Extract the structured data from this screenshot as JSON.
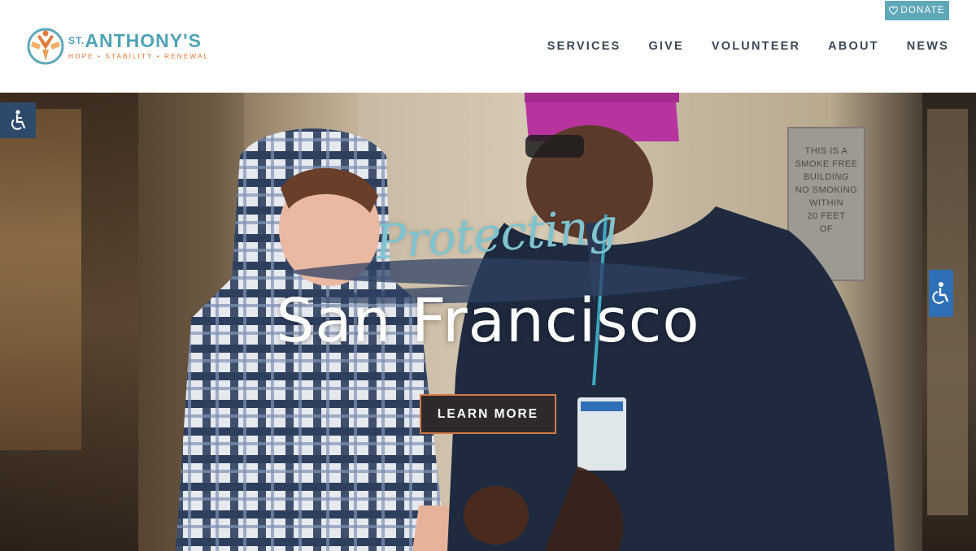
{
  "header": {
    "donate_label": "DONATE",
    "logo": {
      "name_prefix": "ST.",
      "name": "ANTHONY'S",
      "tagline": "HOPE • STABILITY • RENEWAL"
    },
    "nav": [
      {
        "label": "SERVICES"
      },
      {
        "label": "GIVE"
      },
      {
        "label": "VOLUNTEER"
      },
      {
        "label": "ABOUT"
      },
      {
        "label": "NEWS"
      }
    ]
  },
  "hero": {
    "script_text": "Protecting",
    "headline": "San Francisco",
    "cta_label": "LEARN MORE",
    "sign_lines": [
      "THIS IS A",
      "SMOKE FREE",
      "BUILDING",
      "NO SMOKING",
      "WITHIN",
      "20 FEET",
      "OF"
    ]
  },
  "colors": {
    "brand_teal": "#5fa8b8",
    "brand_orange": "#e07a3c",
    "nav_text": "#3a4656",
    "accessibility_bg": "#2e4a6b",
    "cta_border": "#d27a47"
  },
  "icons": {
    "donate": "heart-icon",
    "accessibility": "wheelchair-icon"
  }
}
